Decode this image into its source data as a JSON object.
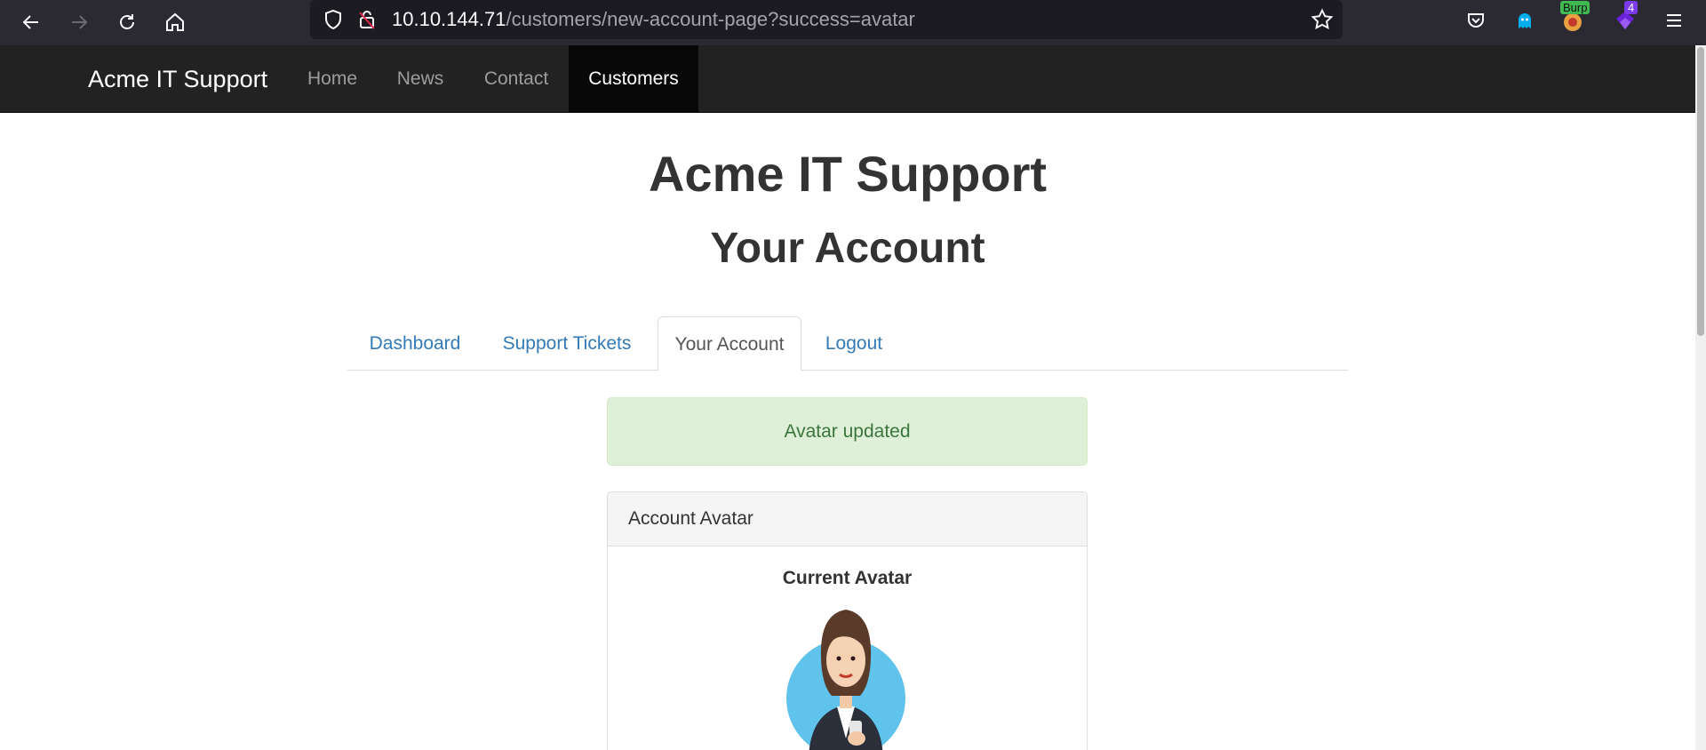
{
  "browser": {
    "url_host": "10.10.144.71",
    "url_path": "/customers/new-account-page?success=avatar",
    "extensions": {
      "burp_badge": "Burp",
      "count_badge": "4"
    }
  },
  "navbar": {
    "brand": "Acme IT Support",
    "items": [
      {
        "label": "Home"
      },
      {
        "label": "News"
      },
      {
        "label": "Contact"
      },
      {
        "label": "Customers"
      }
    ]
  },
  "page": {
    "title": "Acme IT Support",
    "subtitle": "Your Account"
  },
  "tabs": [
    {
      "label": "Dashboard"
    },
    {
      "label": "Support Tickets"
    },
    {
      "label": "Your Account",
      "active": true
    },
    {
      "label": "Logout"
    }
  ],
  "alert": {
    "message": "Avatar updated"
  },
  "panel": {
    "heading": "Account Avatar",
    "current_avatar_label": "Current Avatar"
  },
  "colors": {
    "navbar_bg": "#222222",
    "active_nav_bg": "#080808",
    "link": "#337ab7",
    "alert_bg": "#dff0d8",
    "alert_text": "#3c763d"
  }
}
